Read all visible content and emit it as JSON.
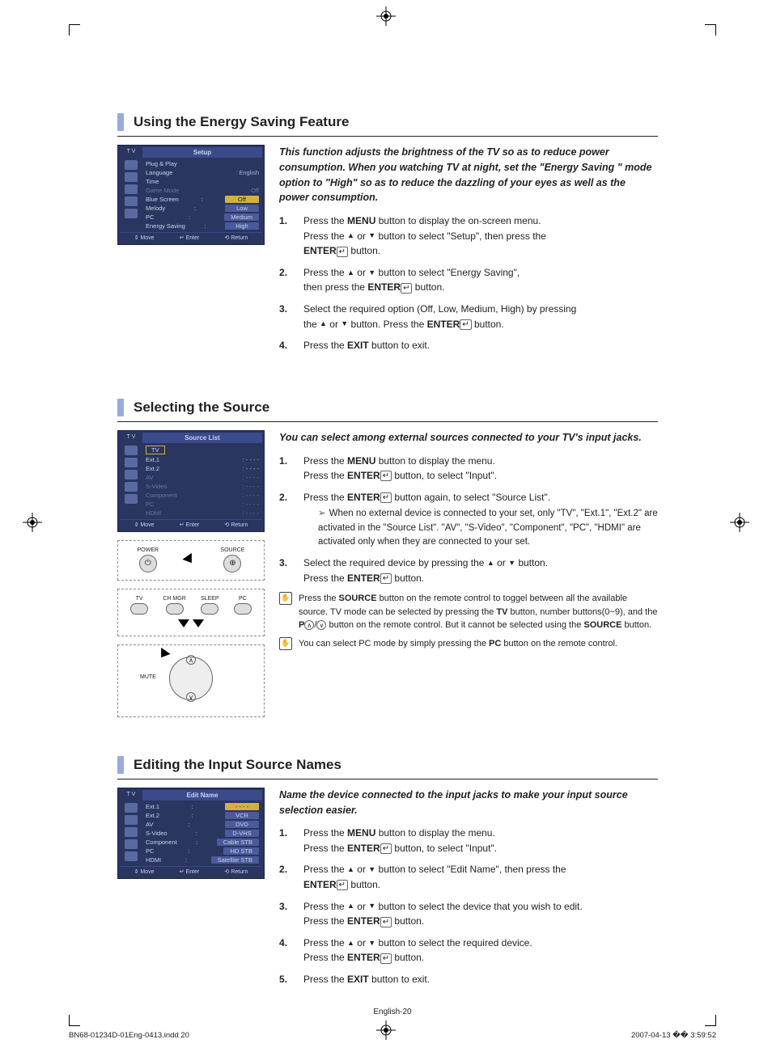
{
  "section1": {
    "title": "Using the Energy Saving Feature",
    "intro": "This function adjusts the brightness of the TV so as to reduce power consumption. When you watching TV at night, set the  \"Energy Saving \" mode option to \"High\" so as to reduce the dazzling of your eyes as well as the power consumption.",
    "osd": {
      "tv": "T V",
      "title": "Setup",
      "rows": [
        {
          "lbl": "Plug & Play",
          "val": ""
        },
        {
          "lbl": "Language",
          "val": ": English"
        },
        {
          "lbl": "Time",
          "val": ""
        },
        {
          "lbl": "Game Mode",
          "val": ": Off",
          "dim": true
        },
        {
          "lbl": "Blue Screen",
          "val": "Off",
          "hl": true
        },
        {
          "lbl": "Melody",
          "val": "Low",
          "btn": true
        },
        {
          "lbl": "PC",
          "val": "Medium",
          "btn": true
        },
        {
          "lbl": "Energy Saving",
          "val": "High",
          "btn": true
        }
      ],
      "foot": [
        "Move",
        "Enter",
        "Return"
      ]
    },
    "steps": {
      "s1a": "Press the ",
      "s1b": " button to display the on-screen menu.",
      "s1c": "Press the ",
      "s1d": " button to select \"Setup\", then press the ",
      "s1e": " button.",
      "s2a": "Press the ",
      "s2b": " button to select \"Energy Saving\",",
      "s2c": "then press the ",
      "s2d": " button.",
      "s3a": "Select the required option (Off, Low, Medium, High) by pressing",
      "s3b": "the ",
      "s3c": " button. Press the ",
      "s3d": " button.",
      "s4a": "Press the ",
      "s4b": " button to exit."
    },
    "labels": {
      "menu": "MENU",
      "enter": "ENTER",
      "exit": "EXIT",
      "or": " or "
    }
  },
  "section2": {
    "title": "Selecting the Source",
    "intro": "You can select among external sources connected to your TV's input jacks.",
    "osd": {
      "tv": "T V",
      "title": "Source List",
      "rows": [
        {
          "lbl": "TV",
          "val": "",
          "sel": true
        },
        {
          "lbl": "Ext.1",
          "val": ": - - - -"
        },
        {
          "lbl": "Ext.2",
          "val": ": - - - -"
        },
        {
          "lbl": "AV",
          "val": ": - - - -",
          "dim": true
        },
        {
          "lbl": "S-Video",
          "val": ": - - - -",
          "dim": true
        },
        {
          "lbl": "Component",
          "val": ": - - - -",
          "dim": true
        },
        {
          "lbl": "PC",
          "val": ": - - - -",
          "dim": true
        },
        {
          "lbl": "HDMI",
          "val": ": - - - -",
          "dim": true
        }
      ],
      "foot": [
        "Move",
        "Enter",
        "Return"
      ]
    },
    "remote": {
      "power": "POWER",
      "source": "SOURCE",
      "row2": [
        "TV",
        "CH MGR",
        "SLEEP",
        "PC"
      ],
      "mute": "MUTE"
    },
    "steps": {
      "s1a": "Press the ",
      "s1b": " button to display the menu.",
      "s1c": "Press the ",
      "s1d": " button, to select \"Input\".",
      "s2a": "Press the ",
      "s2b": " button again, to select \"Source List\".",
      "sub": "When no external device is connected to your set, only \"TV\", \"Ext.1\", \"Ext.2\" are activated in the \"Source List\". \"AV\", \"S-Video\", \"Component\", \"PC\", \"HDMI\" are activated only when they are connected to your set.",
      "s3a": "Select the required device by pressing the ",
      "s3b": " button.",
      "s3c": "Press the ",
      "s3d": " button."
    },
    "note1a": "Press the ",
    "note1b": " button on the remote control to toggel between all the available source. TV mode can be selected by pressing the ",
    "note1c": " button, number buttons(0~9), and the ",
    "note1d": " button on the remote control. But it cannot be selected using the ",
    "note1e": " button.",
    "note2a": "You can select PC mode by simply pressing the  ",
    "note2b": " button on the remote control.",
    "labels": {
      "menu": "MENU",
      "enter": "ENTER",
      "source": "SOURCE",
      "tv": "TV",
      "p": "P",
      "pc": "PC",
      "or": " or "
    }
  },
  "section3": {
    "title": "Editing the Input Source Names",
    "intro": "Name the device connected to the input jacks to make your input source selection easier.",
    "osd": {
      "tv": "T V",
      "title": "Edit Name",
      "rows": [
        {
          "lbl": "Ext.1",
          "val": "- - - -",
          "hl": true
        },
        {
          "lbl": "Ext.2",
          "val": "VCR",
          "btn": true
        },
        {
          "lbl": "AV",
          "val": "DVD",
          "btn": true
        },
        {
          "lbl": "S-Video",
          "val": "D-VHS",
          "btn": true
        },
        {
          "lbl": "Component",
          "val": "Cable STB",
          "btn": true
        },
        {
          "lbl": "PC",
          "val": "HD STB",
          "btn": true
        },
        {
          "lbl": "HDMI",
          "val": "Satellite STB",
          "btn": true
        }
      ],
      "foot": [
        "Move",
        "Enter",
        "Return"
      ]
    },
    "steps": {
      "s1a": "Press the ",
      "s1b": " button to display the menu.",
      "s1c": "Press the ",
      "s1d": " button, to select \"Input\".",
      "s2a": "Press the ",
      "s2b": " button to select \"Edit Name\", then press the ",
      "s2c": " button.",
      "s3a": "Press the ",
      "s3b": " button to select the device that you wish to edit.",
      "s3c": "Press the ",
      "s3d": "  button.",
      "s4a": "Press the ",
      "s4b": " button to select the required device.",
      "s4c": "Press the ",
      "s4d": " button.",
      "s5a": "Press the ",
      "s5b": " button to exit."
    },
    "labels": {
      "menu": "MENU",
      "enter": "ENTER",
      "exit": "EXIT",
      "or": " or "
    }
  },
  "footer": "English-20",
  "print": {
    "left": "BN68-01234D-01Eng-0413.indd   20",
    "right": "2007-04-13   �� 3:59:52"
  }
}
